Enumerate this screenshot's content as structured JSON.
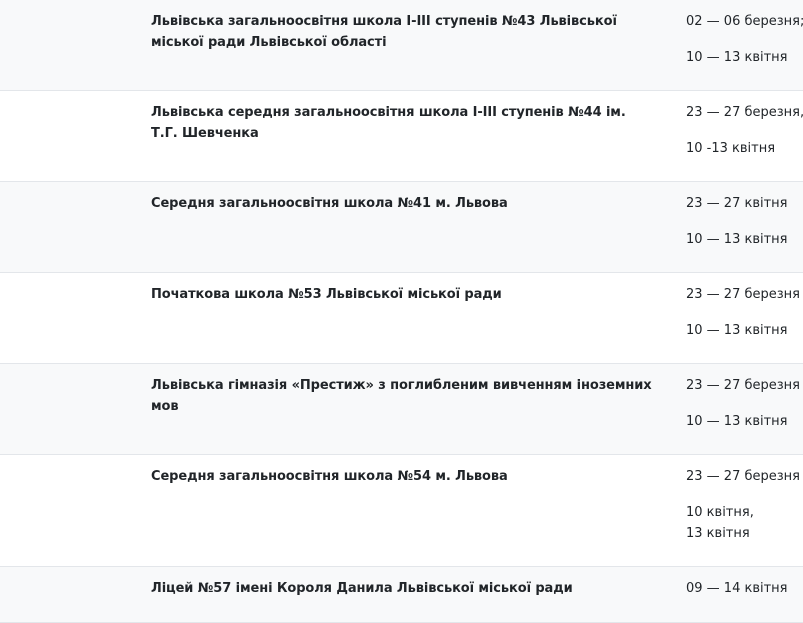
{
  "rows": [
    {
      "school": "Львівська загальноосвітня школа І-ІІІ ступенів №43 Львівської міської ради Львівської області",
      "dates": [
        "02 — 06 березня;",
        "10 — 13 квітня"
      ]
    },
    {
      "school": "Львівська середня загальноосвітня школа І-ІІІ ступенів №44 ім. Т.Г. Шевченка",
      "dates": [
        "23 — 27 березня,",
        "10 -13 квітня"
      ]
    },
    {
      "school": "Середня загальноосвітня школа №41 м. Львова",
      "dates": [
        "23 — 27 квітня",
        "10 — 13 квітня"
      ]
    },
    {
      "school": "Початкова школа №53 Львівської міської ради",
      "dates": [
        "23 — 27 березня",
        "10 — 13 квітня"
      ]
    },
    {
      "school": "Львівська гімназія «Престиж» з поглибленим вивченням іноземних мов",
      "dates": [
        "23 — 27 березня",
        "10 — 13 квітня"
      ]
    },
    {
      "school": "Середня загальноосвітня школа №54 м. Львова",
      "dates": [
        "23 — 27 березня",
        "10 квітня,",
        "13 квітня"
      ]
    },
    {
      "school": "Ліцей №57 імені Короля Данила Львівської міської ради",
      "dates": [
        "09 — 14 квітня"
      ]
    }
  ]
}
